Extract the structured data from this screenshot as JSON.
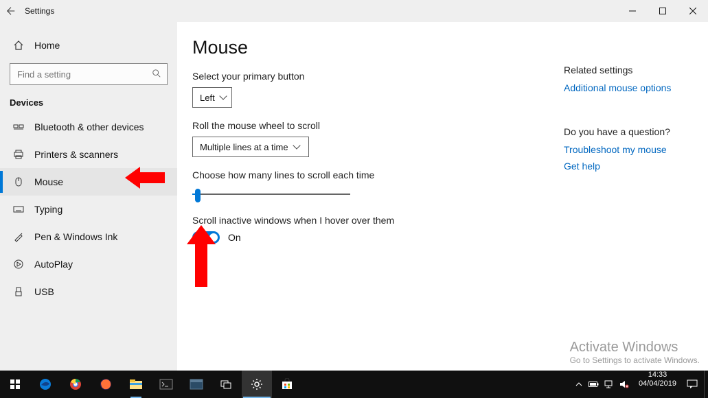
{
  "titlebar": {
    "title": "Settings"
  },
  "sidebar": {
    "home_label": "Home",
    "search_placeholder": "Find a setting",
    "category_label": "Devices",
    "items": [
      {
        "label": "Bluetooth & other devices"
      },
      {
        "label": "Printers & scanners"
      },
      {
        "label": "Mouse"
      },
      {
        "label": "Typing"
      },
      {
        "label": "Pen & Windows Ink"
      },
      {
        "label": "AutoPlay"
      },
      {
        "label": "USB"
      }
    ]
  },
  "page": {
    "title": "Mouse",
    "primary_button_label": "Select your primary button",
    "primary_button_value": "Left",
    "scroll_mode_label": "Roll the mouse wheel to scroll",
    "scroll_mode_value": "Multiple lines at a time",
    "lines_label": "Choose how many lines to scroll each time",
    "inactive_label": "Scroll inactive windows when I hover over them",
    "inactive_value": "On"
  },
  "right": {
    "related_heading": "Related settings",
    "related_link": "Additional mouse options",
    "question_heading": "Do you have a question?",
    "troubleshoot_link": "Troubleshoot my mouse",
    "help_link": "Get help"
  },
  "watermark": {
    "line1": "Activate Windows",
    "line2": "Go to Settings to activate Windows."
  },
  "taskbar": {
    "time": "14:33",
    "date": "04/04/2019"
  }
}
